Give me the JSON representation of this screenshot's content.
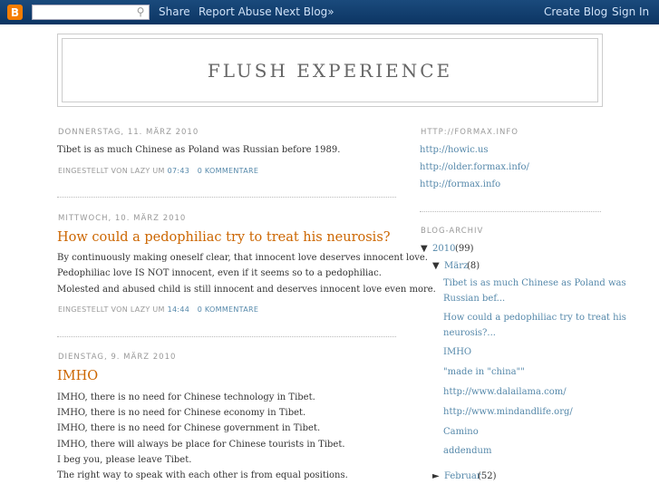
{
  "navbar": {
    "logo": "B",
    "search": {
      "value": "",
      "placeholder": ""
    },
    "search_icon": "magnifier",
    "links": {
      "share": "Share",
      "report_abuse": "Report Abuse",
      "next_blog": "Next Blog»"
    },
    "right": {
      "create_blog": "Create Blog",
      "sign_in": "Sign In"
    }
  },
  "header": {
    "title": "FLUSH EXPERIENCE"
  },
  "posts": [
    {
      "date": "DONNERSTAG, 11. MÄRZ 2010",
      "title": "",
      "body": [
        "Tibet is as much Chinese as Poland was Russian before 1989."
      ],
      "footer": {
        "prefix": "EINGESTELLT VON LAZY UM",
        "time": "07:43",
        "comments": "0 KOMMENTARE"
      }
    },
    {
      "date": "MITTWOCH, 10. MÄRZ 2010",
      "title": "How could a pedophiliac try to treat his neurosis?",
      "body": [
        "By continuously making oneself clear, that innocent love deserves innocent love.",
        "Pedophiliac love IS NOT innocent, even if it seems so to a pedophiliac.",
        "Molested and abused child is still innocent and deserves innocent love even more."
      ],
      "footer": {
        "prefix": "EINGESTELLT VON LAZY UM",
        "time": "14:44",
        "comments": "0 KOMMENTARE"
      }
    },
    {
      "date": "DIENSTAG, 9. MÄRZ 2010",
      "title": "IMHO",
      "body": [
        "IMHO, there is no need for Chinese technology in Tibet.",
        "IMHO, there is no need for Chinese economy in Tibet.",
        "IMHO, there is no need for Chinese government in Tibet.",
        "IMHO, there will always be place for Chinese tourists in Tibet.",
        "I beg you, please leave Tibet.",
        "The right way to speak with each other is from equal positions."
      ]
    }
  ],
  "sidebar": {
    "links_heading": "HTTP://FORMAX.INFO",
    "links": [
      "http://howic.us",
      "http://older.formax.info/",
      "http://formax.info"
    ],
    "archive_heading": "BLOG-ARCHIV",
    "archive": {
      "year": {
        "label": "2010",
        "count": "(99)",
        "toggle": "▼"
      },
      "month": {
        "label": "März",
        "count": "(8)",
        "toggle": "▼"
      },
      "posts": [
        "Tibet is as much Chinese as Poland was",
        "Russian bef...",
        "How could a pedophiliac try to treat his",
        "neurosis?...",
        "IMHO",
        "\"made in \"china\"\"",
        "http://www.dalailama.com/",
        "http://www.mindandlife.org/",
        "Camino",
        "addendum"
      ],
      "next_month": {
        "label": "Februar",
        "count": "(52)",
        "toggle": "►"
      }
    }
  }
}
